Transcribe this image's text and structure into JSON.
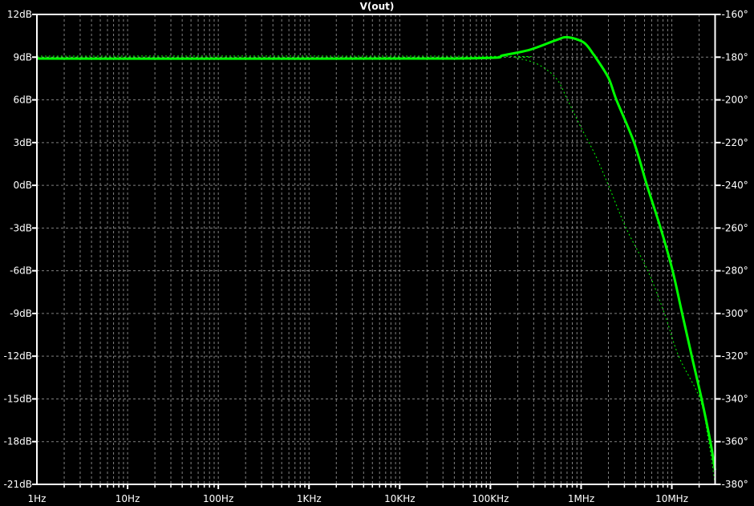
{
  "chart_data": {
    "type": "line",
    "title": "V(out)",
    "xscale": "log",
    "xlim": [
      1,
      30000000
    ],
    "xticks": [
      {
        "value": 1,
        "label": "1Hz"
      },
      {
        "value": 10,
        "label": "10Hz"
      },
      {
        "value": 100,
        "label": "100Hz"
      },
      {
        "value": 1000,
        "label": "1KHz"
      },
      {
        "value": 10000,
        "label": "10KHz"
      },
      {
        "value": 100000,
        "label": "100KHz"
      },
      {
        "value": 1000000,
        "label": "1MHz"
      },
      {
        "value": 10000000,
        "label": "10MHz"
      }
    ],
    "ylim_left": [
      -21,
      12
    ],
    "yticks_left": [
      {
        "value": 12,
        "label": "12dB"
      },
      {
        "value": 9,
        "label": "9dB"
      },
      {
        "value": 6,
        "label": "6dB"
      },
      {
        "value": 3,
        "label": "3dB"
      },
      {
        "value": 0,
        "label": "0dB"
      },
      {
        "value": -3,
        "label": "-3dB"
      },
      {
        "value": -6,
        "label": "-6dB"
      },
      {
        "value": -9,
        "label": "-9dB"
      },
      {
        "value": -12,
        "label": "-12dB"
      },
      {
        "value": -15,
        "label": "-15dB"
      },
      {
        "value": -18,
        "label": "-18dB"
      },
      {
        "value": -21,
        "label": "-21dB"
      }
    ],
    "ylim_right": [
      -380,
      -160
    ],
    "yticks_right": [
      {
        "value": -160,
        "label": "-160°"
      },
      {
        "value": -180,
        "label": "-180°"
      },
      {
        "value": -200,
        "label": "-200°"
      },
      {
        "value": -220,
        "label": "-220°"
      },
      {
        "value": -240,
        "label": "-240°"
      },
      {
        "value": -260,
        "label": "-260°"
      },
      {
        "value": -280,
        "label": "-280°"
      },
      {
        "value": -300,
        "label": "-300°"
      },
      {
        "value": -320,
        "label": "-320°"
      },
      {
        "value": -340,
        "label": "-340°"
      },
      {
        "value": -360,
        "label": "-360°"
      },
      {
        "value": -380,
        "label": "-380°"
      }
    ],
    "grid": true,
    "colors": {
      "background": "#000000",
      "axis": "#ffffff",
      "grid": "#808080",
      "trace": "#00ff00"
    },
    "series": [
      {
        "kind": "magnitude",
        "axis": "left",
        "style": "solid",
        "points": [
          [
            1,
            8.9
          ],
          [
            10000,
            8.9
          ],
          [
            100000,
            8.95
          ],
          [
            138000,
            9.13
          ],
          [
            272000,
            9.52
          ],
          [
            533000,
            10.2
          ],
          [
            708000,
            10.4
          ],
          [
            1070000,
            10.03
          ],
          [
            1370000,
            9.19
          ],
          [
            1440000,
            9.0
          ],
          [
            2000000,
            7.55
          ],
          [
            2450000,
            6
          ],
          [
            3840000,
            3
          ],
          [
            5320000,
            0
          ],
          [
            7520000,
            -3
          ],
          [
            10200000,
            -6
          ],
          [
            13000000,
            -9
          ],
          [
            16600000,
            -12
          ],
          [
            21300000,
            -15
          ],
          [
            26600000,
            -18
          ],
          [
            30000000,
            -20
          ]
        ]
      },
      {
        "kind": "phase",
        "axis": "right",
        "style": "dashed",
        "points": [
          [
            1,
            -179.5
          ],
          [
            100000,
            -179.6
          ],
          [
            192000,
            -180.5
          ],
          [
            332000,
            -183.3
          ],
          [
            533000,
            -190
          ],
          [
            708000,
            -200
          ],
          [
            1000000,
            -213
          ],
          [
            1440000,
            -226
          ],
          [
            2000000,
            -240
          ],
          [
            3130000,
            -260
          ],
          [
            5430000,
            -280
          ],
          [
            8300000,
            -300
          ],
          [
            11900000,
            -320
          ],
          [
            20400000,
            -340
          ],
          [
            25500000,
            -360
          ],
          [
            30000000,
            -380
          ]
        ]
      }
    ]
  }
}
